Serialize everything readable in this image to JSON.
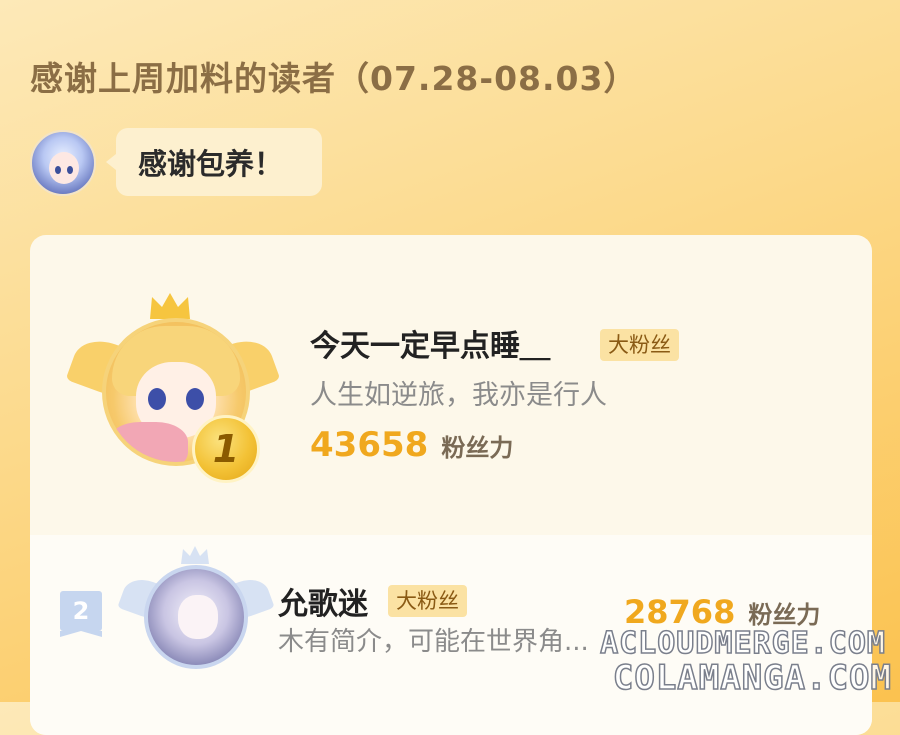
{
  "page_title": "感谢上周加料的读者（07.28-08.03）",
  "host": {
    "avatar": "anime-girl-avatar",
    "bubble_text": "感谢包养！"
  },
  "ranking": [
    {
      "rank": "1",
      "name": "今天一定早点睡＿",
      "tag": "大粉丝",
      "bio": "人生如逆旅，我亦是行人",
      "score": "43658",
      "score_label": "粉丝力",
      "badge_color": "#f3c236"
    },
    {
      "rank": "2",
      "name": "允歌迷",
      "tag": "大粉丝",
      "bio": "木有简介，可能在世界角...",
      "score": "28768",
      "score_label": "粉丝力",
      "badge_color": "#c6d6ef"
    }
  ],
  "watermark": {
    "line1": "ACLOUDMERGE.COM",
    "line2": "COLAMANGA.COM"
  },
  "colors": {
    "accent": "#f0a81e",
    "title": "#8b6e45",
    "card": "#fdf8ea"
  }
}
